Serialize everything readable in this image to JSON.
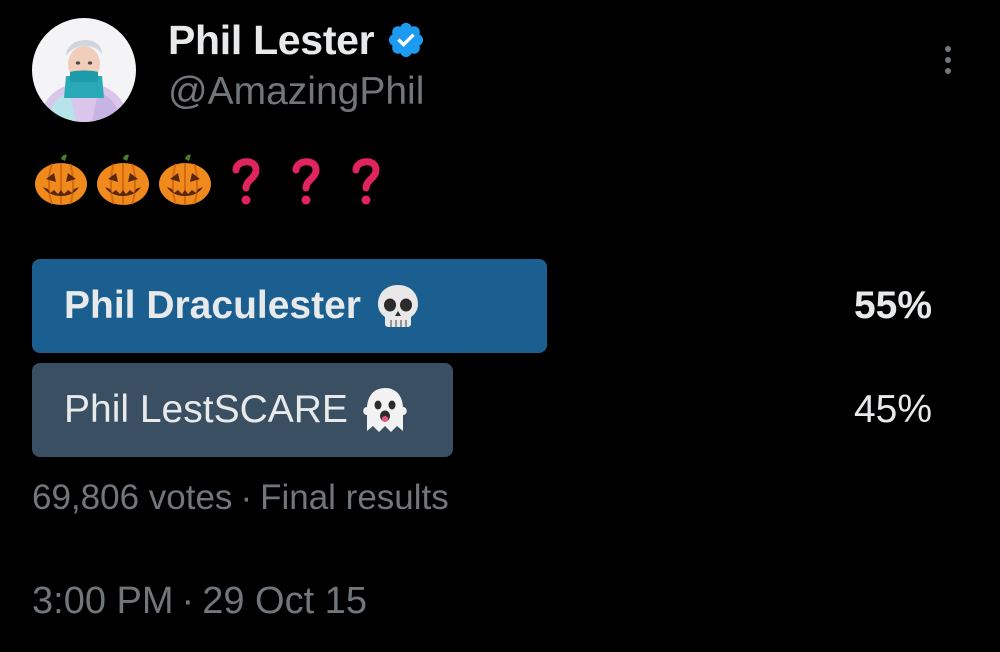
{
  "author": {
    "display_name": "Phil Lester",
    "handle": "@AmazingPhil",
    "verified": true
  },
  "tweet": {
    "text": "🎃🎃🎃❓❓❓",
    "emojis": [
      "jack-o-lantern",
      "jack-o-lantern",
      "jack-o-lantern",
      "red-question-mark",
      "red-question-mark",
      "red-question-mark"
    ]
  },
  "poll": {
    "options": [
      {
        "label": "Phil Draculester",
        "emoji": "skull",
        "percent_label": "55%",
        "percent": 55,
        "winner": true
      },
      {
        "label": "Phil LestSCARE",
        "emoji": "ghost",
        "percent_label": "45%",
        "percent": 45,
        "winner": false
      }
    ],
    "votes": "69,806 votes",
    "separator": "·",
    "status": "Final results"
  },
  "timestamp": {
    "time": "3:00 PM",
    "separator": "·",
    "date": "29 Oct 15"
  },
  "colors": {
    "background": "#000000",
    "primary_text": "#e7e9ea",
    "secondary_text": "#71767b",
    "verified_blue": "#1d9bf0",
    "winner_bar": "#1a5f8f",
    "loser_bar": "#3b4f62"
  }
}
